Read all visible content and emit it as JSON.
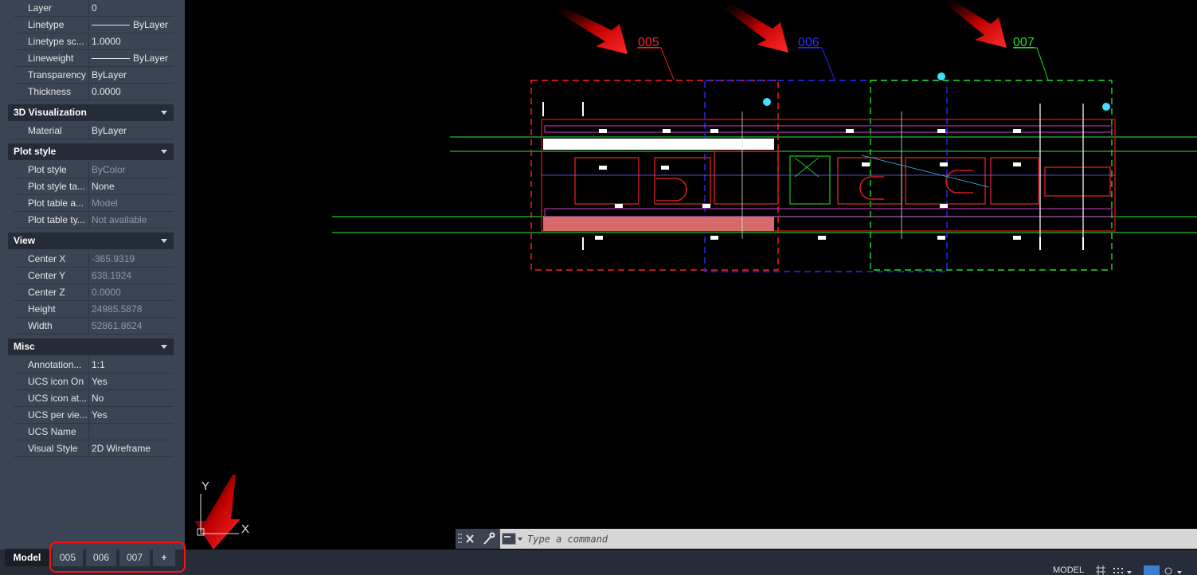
{
  "properties": {
    "general": [
      {
        "name": "Layer",
        "value": "0"
      },
      {
        "name": "Linetype",
        "value": "ByLayer",
        "line": true
      },
      {
        "name": "Linetype sc...",
        "value": "1.0000"
      },
      {
        "name": "Lineweight",
        "value": "ByLayer",
        "line": true
      },
      {
        "name": "Transparency",
        "value": "ByLayer"
      },
      {
        "name": "Thickness",
        "value": "0.0000"
      }
    ],
    "viz_title": "3D Visualization",
    "viz": [
      {
        "name": "Material",
        "value": "ByLayer"
      }
    ],
    "plot_title": "Plot style",
    "plot": [
      {
        "name": "Plot style",
        "value": "ByColor",
        "dim": true
      },
      {
        "name": "Plot style ta...",
        "value": "None"
      },
      {
        "name": "Plot table a...",
        "value": "Model",
        "dim": true
      },
      {
        "name": "Plot table ty...",
        "value": "Not available",
        "dim": true
      }
    ],
    "view_title": "View",
    "view": [
      {
        "name": "Center X",
        "value": "-365.9319",
        "dim": true
      },
      {
        "name": "Center Y",
        "value": "638.1924",
        "dim": true
      },
      {
        "name": "Center Z",
        "value": "0.0000",
        "dim": true
      },
      {
        "name": "Height",
        "value": "24985.5878",
        "dim": true
      },
      {
        "name": "Width",
        "value": "52861.8624",
        "dim": true
      }
    ],
    "misc_title": "Misc",
    "misc": [
      {
        "name": "Annotation...",
        "value": "1:1"
      },
      {
        "name": "UCS icon On",
        "value": "Yes"
      },
      {
        "name": "UCS icon at...",
        "value": "No"
      },
      {
        "name": "UCS per vie...",
        "value": "Yes"
      },
      {
        "name": "UCS Name",
        "value": ""
      },
      {
        "name": "Visual Style",
        "value": "2D Wireframe"
      }
    ]
  },
  "drawing": {
    "labels": [
      {
        "text": "005",
        "color": "#ff2020"
      },
      {
        "text": "006",
        "color": "#2a2aff"
      },
      {
        "text": "007",
        "color": "#20e020"
      }
    ],
    "ucs_y": "Y",
    "ucs_x": "X"
  },
  "layout_tabs": [
    {
      "label": "Model",
      "active": true
    },
    {
      "label": "005"
    },
    {
      "label": "006"
    },
    {
      "label": "007"
    }
  ],
  "new_layout_label": "+",
  "command": {
    "placeholder": "Type a command"
  },
  "status": {
    "model_label": "MODEL"
  },
  "colors": {
    "accent_red": "#ff1010",
    "panel": "#3b4453",
    "canvas": "#000000"
  }
}
